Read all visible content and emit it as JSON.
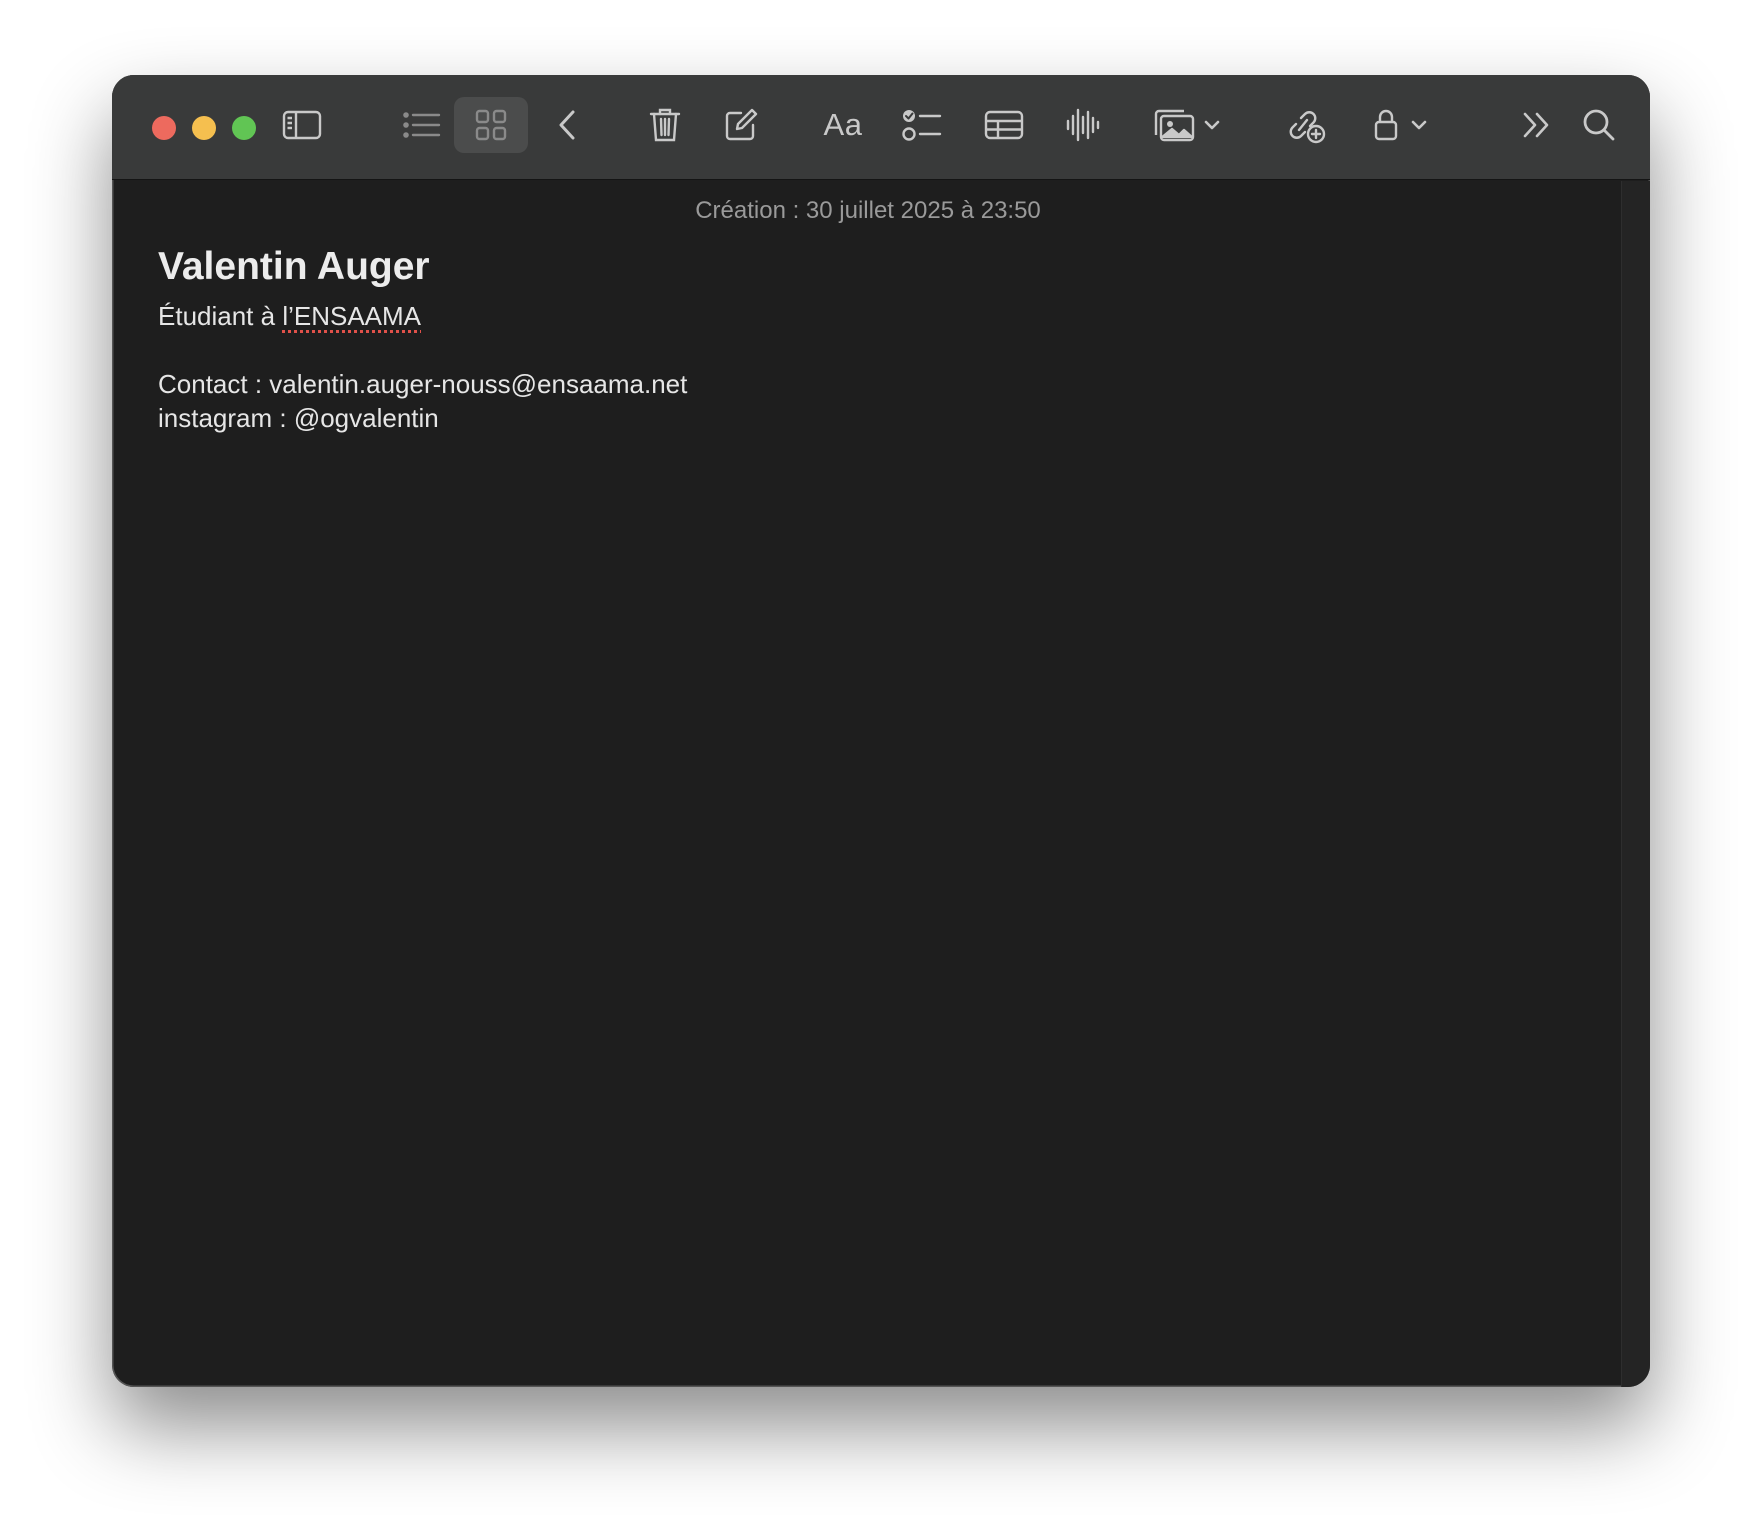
{
  "window": {
    "traffic_lights": [
      "close",
      "minimize",
      "maximize"
    ]
  },
  "toolbar": {
    "buttons": [
      {
        "name": "sidebar-toggle",
        "icon": "sidebar-icon"
      },
      {
        "name": "list-view",
        "icon": "list-icon"
      },
      {
        "name": "gallery-view",
        "icon": "grid-icon",
        "selected": true
      },
      {
        "name": "back",
        "icon": "chevron-left-icon"
      },
      {
        "name": "delete",
        "icon": "trash-icon"
      },
      {
        "name": "new-note",
        "icon": "compose-icon"
      },
      {
        "name": "format",
        "icon": "text-format-icon"
      },
      {
        "name": "checklist",
        "icon": "checklist-icon"
      },
      {
        "name": "table",
        "icon": "table-icon"
      },
      {
        "name": "audio",
        "icon": "waveform-icon"
      },
      {
        "name": "media",
        "icon": "photo-icon"
      },
      {
        "name": "collaborate",
        "icon": "link-add-icon"
      },
      {
        "name": "lock",
        "icon": "lock-icon"
      },
      {
        "name": "more",
        "icon": "chevron-double-right-icon"
      },
      {
        "name": "search",
        "icon": "search-icon"
      }
    ],
    "format_label": "Aa"
  },
  "note": {
    "created": "Création : 30 juillet 2025 à 23:50",
    "title": "Valentin Auger",
    "subtitle_prefix": "Étudiant à ",
    "subtitle_word": "l’ENSAAMA",
    "contact": "Contact : valentin.auger-nouss@ensaama.net",
    "instagram": "instagram : @ogvalentin"
  },
  "colors": {
    "close": "#ed6a5e",
    "minimize": "#f5bf4f",
    "maximize": "#61c554",
    "background": "#1e1e1e",
    "toolbar": "#393a3a"
  }
}
